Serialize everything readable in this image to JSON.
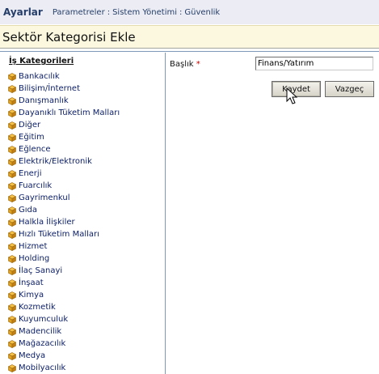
{
  "header": {
    "app_name": "Ayarlar",
    "breadcrumb": [
      "Parametreler",
      "Sistem Yönetimi",
      "Güvenlik"
    ],
    "separator": ":"
  },
  "page": {
    "title": "Sektör Kategorisi Ekle"
  },
  "sidebar": {
    "heading": "İş Kategorileri",
    "item_icon": "cube-icon",
    "items": [
      "Bankacılık",
      "Bilişim/İnternet",
      "Danışmanlık",
      "Dayanıklı Tüketim Malları",
      "Diğer",
      "Eğitim",
      "Eğlence",
      "Elektrik/Elektronik",
      "Enerji",
      "Fuarcılık",
      "Gayrimenkul",
      "Gıda",
      "Halkla İlişkiler",
      "Hızlı Tüketim Malları",
      "Hizmet",
      "Holding",
      "İlaç Sanayi",
      "İnşaat",
      "Kimya",
      "Kozmetik",
      "Kuyumculuk",
      "Madencilik",
      "Mağazacılık",
      "Medya",
      "Mobilyacılık"
    ]
  },
  "form": {
    "title_label": "Başlık",
    "required_mark": "*",
    "title_value": "Finans/Yatırım",
    "save_label": "Kaydet",
    "cancel_label": "Vazgeç"
  },
  "colors": {
    "topbar_bg": "#ecedf4",
    "titlebar_bg": "#fbf8df",
    "link_color": "#0a1d66",
    "border_blue": "#7d98b8",
    "cube_orange": "#e0a020"
  }
}
